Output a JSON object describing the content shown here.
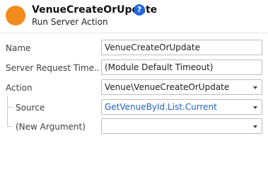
{
  "header": {
    "title": "VenueCreateOrUpdate",
    "subtitle": "Run Server Action",
    "help_glyph": "?",
    "icon": "server-action-icon",
    "accent_color": "#f28a1d",
    "help_color": "#2266dd"
  },
  "properties": {
    "name": {
      "label": "Name",
      "value": "VenueCreateOrUpdate"
    },
    "timeout": {
      "label": "Server Request Time...",
      "value": "(Module Default Timeout)"
    },
    "action": {
      "label": "Action",
      "value": "Venue\\VenueCreateOrUpdate"
    },
    "source": {
      "label": "Source",
      "value": "GetVenueById.List.Current"
    },
    "new_argument": {
      "label": "(New Argument)",
      "value": ""
    }
  }
}
